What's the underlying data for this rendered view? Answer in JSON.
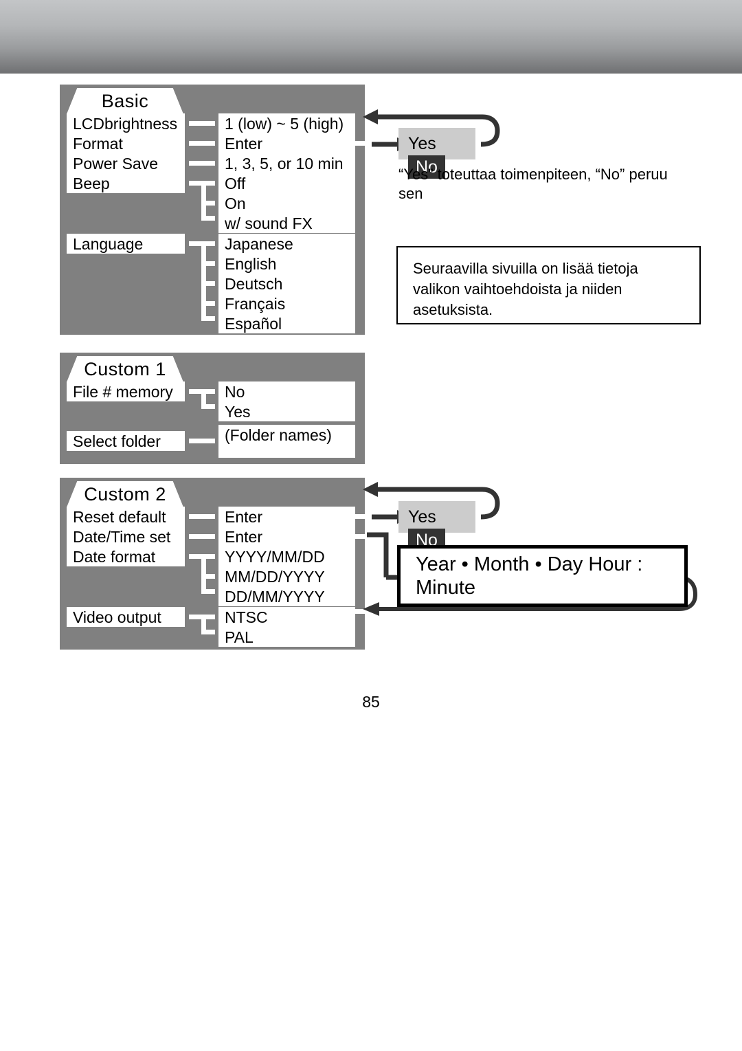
{
  "page": {
    "number": "85"
  },
  "sections": [
    {
      "id": "basic",
      "tab_label": "Basic",
      "left_items": [
        {
          "label": "LCDbrightness"
        },
        {
          "label": "Format"
        },
        {
          "label": "Power Save"
        },
        {
          "label": "Beep"
        },
        {
          "label": "Language"
        }
      ],
      "right_items": [
        {
          "label": "1 (low) ~ 5 (high)"
        },
        {
          "label": "Enter"
        },
        {
          "label": "1, 3, 5, or 10 min"
        },
        {
          "label": "Off"
        },
        {
          "label": "On"
        },
        {
          "label": "w/ sound FX"
        },
        {
          "label": "Japanese"
        },
        {
          "label": "English"
        },
        {
          "label": "Deutsch"
        },
        {
          "label": "Français"
        },
        {
          "label": "Español"
        }
      ]
    },
    {
      "id": "custom1",
      "tab_label": "Custom 1",
      "left_items": [
        {
          "label": "File # memory"
        },
        {
          "label": "Select folder"
        }
      ],
      "right_items": [
        {
          "label": "No"
        },
        {
          "label": "Yes"
        },
        {
          "label": "(Folder names)"
        }
      ]
    },
    {
      "id": "custom2",
      "tab_label": "Custom 2",
      "left_items": [
        {
          "label": "Reset default"
        },
        {
          "label": "Date/Time set"
        },
        {
          "label": "Date format"
        },
        {
          "label": "Video output"
        }
      ],
      "right_items": [
        {
          "label": "Enter"
        },
        {
          "label": "Enter"
        },
        {
          "label": "YYYY/MM/DD"
        },
        {
          "label": "MM/DD/YYYY"
        },
        {
          "label": "DD/MM/YYYY"
        },
        {
          "label": "NTSC"
        },
        {
          "label": "PAL"
        }
      ]
    }
  ],
  "confirm_basic": {
    "yes_label": "Yes",
    "no_label": "No"
  },
  "confirm_custom2": {
    "yes_label": "Yes",
    "no_label": "No"
  },
  "caption_basic": "“Yes” toteuttaa toimenpiteen, “No” peruu sen",
  "note": "Seuraavilla sivuilla on lisää tietoja valikon vaihtoehdoista ja niiden asetuksista.",
  "datetime_box": {
    "label": "Year • Month • Day  Hour : Minute"
  },
  "colors": {
    "panel_grey": "#808080",
    "chip_grey": "#cccccc",
    "chip_dark": "#333333",
    "ink": "#000000",
    "paper": "#ffffff"
  }
}
